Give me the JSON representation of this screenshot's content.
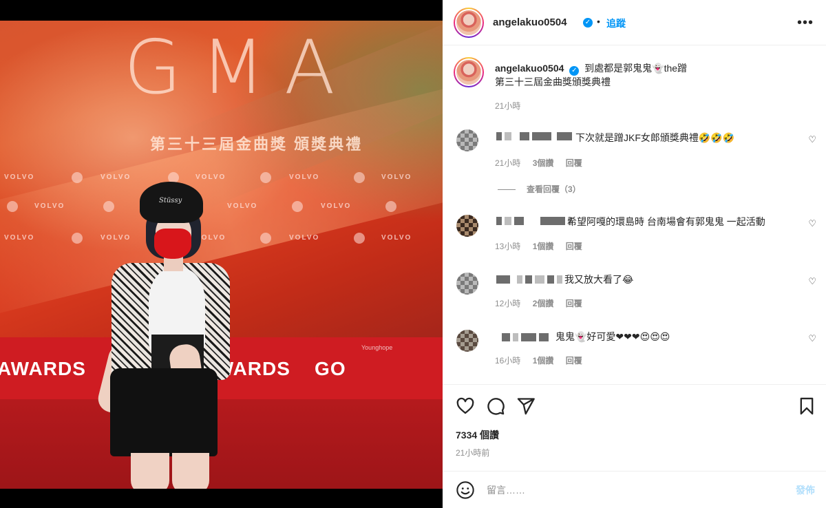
{
  "photo": {
    "backdrop_logo": "GMA",
    "backdrop_subtitle": "第三十三屆金曲獎 頒獎典禮",
    "sponsor": "VOLVO",
    "sponsors_line": "Younghope",
    "band_text": "AWARDS    MELODY AWARDS    GO",
    "hat_text": "Stüssy"
  },
  "header": {
    "username": "angelakuo0504",
    "verified_icon": "✓",
    "separator": "•",
    "follow_label": "追蹤",
    "more_label": "•••"
  },
  "caption": {
    "username": "angelakuo0504",
    "line1": "到處都是郭鬼鬼👻the蹭",
    "line2": "第三十三屆金曲獎頒獎典禮",
    "time": "21小時"
  },
  "comments": [
    {
      "text": "下次就是蹭JKF女郎頒獎典禮🤣🤣🤣",
      "time": "21小時",
      "likes": "3個讚",
      "reply": "回覆"
    },
    {
      "text": "希望阿嘎的環島時 台南場會有郭鬼鬼 一起活動",
      "time": "13小時",
      "likes": "1個讚",
      "reply": "回覆"
    },
    {
      "text": "我又放大看了😂",
      "time": "12小時",
      "likes": "2個讚",
      "reply": "回覆"
    },
    {
      "text": "鬼鬼👻好可愛❤❤❤😍😍😍",
      "time": "16小時",
      "likes": "1個讚",
      "reply": "回覆"
    }
  ],
  "view_replies": "查看回覆（3）",
  "actions": {
    "likes": "7334 個讚",
    "time_ago": "21小時前"
  },
  "add_comment": {
    "placeholder": "留言……",
    "post_label": "發佈"
  },
  "colors": {
    "accent": "#0095f6",
    "post_disabled": "#b2dffc",
    "muted": "#8e8e8e",
    "text": "#262626"
  }
}
